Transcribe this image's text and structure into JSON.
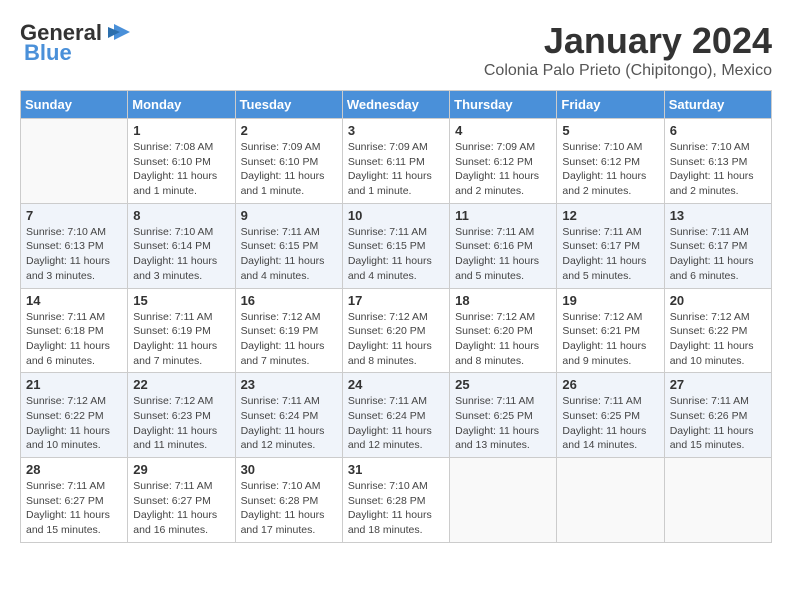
{
  "logo": {
    "general": "General",
    "blue": "Blue"
  },
  "title": {
    "month": "January 2024",
    "location": "Colonia Palo Prieto (Chipitongo), Mexico"
  },
  "headers": [
    "Sunday",
    "Monday",
    "Tuesday",
    "Wednesday",
    "Thursday",
    "Friday",
    "Saturday"
  ],
  "weeks": [
    [
      {
        "day": "",
        "info": ""
      },
      {
        "day": "1",
        "info": "Sunrise: 7:08 AM\nSunset: 6:10 PM\nDaylight: 11 hours\nand 1 minute."
      },
      {
        "day": "2",
        "info": "Sunrise: 7:09 AM\nSunset: 6:10 PM\nDaylight: 11 hours\nand 1 minute."
      },
      {
        "day": "3",
        "info": "Sunrise: 7:09 AM\nSunset: 6:11 PM\nDaylight: 11 hours\nand 1 minute."
      },
      {
        "day": "4",
        "info": "Sunrise: 7:09 AM\nSunset: 6:12 PM\nDaylight: 11 hours\nand 2 minutes."
      },
      {
        "day": "5",
        "info": "Sunrise: 7:10 AM\nSunset: 6:12 PM\nDaylight: 11 hours\nand 2 minutes."
      },
      {
        "day": "6",
        "info": "Sunrise: 7:10 AM\nSunset: 6:13 PM\nDaylight: 11 hours\nand 2 minutes."
      }
    ],
    [
      {
        "day": "7",
        "info": "Sunrise: 7:10 AM\nSunset: 6:13 PM\nDaylight: 11 hours\nand 3 minutes."
      },
      {
        "day": "8",
        "info": "Sunrise: 7:10 AM\nSunset: 6:14 PM\nDaylight: 11 hours\nand 3 minutes."
      },
      {
        "day": "9",
        "info": "Sunrise: 7:11 AM\nSunset: 6:15 PM\nDaylight: 11 hours\nand 4 minutes."
      },
      {
        "day": "10",
        "info": "Sunrise: 7:11 AM\nSunset: 6:15 PM\nDaylight: 11 hours\nand 4 minutes."
      },
      {
        "day": "11",
        "info": "Sunrise: 7:11 AM\nSunset: 6:16 PM\nDaylight: 11 hours\nand 5 minutes."
      },
      {
        "day": "12",
        "info": "Sunrise: 7:11 AM\nSunset: 6:17 PM\nDaylight: 11 hours\nand 5 minutes."
      },
      {
        "day": "13",
        "info": "Sunrise: 7:11 AM\nSunset: 6:17 PM\nDaylight: 11 hours\nand 6 minutes."
      }
    ],
    [
      {
        "day": "14",
        "info": "Sunrise: 7:11 AM\nSunset: 6:18 PM\nDaylight: 11 hours\nand 6 minutes."
      },
      {
        "day": "15",
        "info": "Sunrise: 7:11 AM\nSunset: 6:19 PM\nDaylight: 11 hours\nand 7 minutes."
      },
      {
        "day": "16",
        "info": "Sunrise: 7:12 AM\nSunset: 6:19 PM\nDaylight: 11 hours\nand 7 minutes."
      },
      {
        "day": "17",
        "info": "Sunrise: 7:12 AM\nSunset: 6:20 PM\nDaylight: 11 hours\nand 8 minutes."
      },
      {
        "day": "18",
        "info": "Sunrise: 7:12 AM\nSunset: 6:20 PM\nDaylight: 11 hours\nand 8 minutes."
      },
      {
        "day": "19",
        "info": "Sunrise: 7:12 AM\nSunset: 6:21 PM\nDaylight: 11 hours\nand 9 minutes."
      },
      {
        "day": "20",
        "info": "Sunrise: 7:12 AM\nSunset: 6:22 PM\nDaylight: 11 hours\nand 10 minutes."
      }
    ],
    [
      {
        "day": "21",
        "info": "Sunrise: 7:12 AM\nSunset: 6:22 PM\nDaylight: 11 hours\nand 10 minutes."
      },
      {
        "day": "22",
        "info": "Sunrise: 7:12 AM\nSunset: 6:23 PM\nDaylight: 11 hours\nand 11 minutes."
      },
      {
        "day": "23",
        "info": "Sunrise: 7:11 AM\nSunset: 6:24 PM\nDaylight: 11 hours\nand 12 minutes."
      },
      {
        "day": "24",
        "info": "Sunrise: 7:11 AM\nSunset: 6:24 PM\nDaylight: 11 hours\nand 12 minutes."
      },
      {
        "day": "25",
        "info": "Sunrise: 7:11 AM\nSunset: 6:25 PM\nDaylight: 11 hours\nand 13 minutes."
      },
      {
        "day": "26",
        "info": "Sunrise: 7:11 AM\nSunset: 6:25 PM\nDaylight: 11 hours\nand 14 minutes."
      },
      {
        "day": "27",
        "info": "Sunrise: 7:11 AM\nSunset: 6:26 PM\nDaylight: 11 hours\nand 15 minutes."
      }
    ],
    [
      {
        "day": "28",
        "info": "Sunrise: 7:11 AM\nSunset: 6:27 PM\nDaylight: 11 hours\nand 15 minutes."
      },
      {
        "day": "29",
        "info": "Sunrise: 7:11 AM\nSunset: 6:27 PM\nDaylight: 11 hours\nand 16 minutes."
      },
      {
        "day": "30",
        "info": "Sunrise: 7:10 AM\nSunset: 6:28 PM\nDaylight: 11 hours\nand 17 minutes."
      },
      {
        "day": "31",
        "info": "Sunrise: 7:10 AM\nSunset: 6:28 PM\nDaylight: 11 hours\nand 18 minutes."
      },
      {
        "day": "",
        "info": ""
      },
      {
        "day": "",
        "info": ""
      },
      {
        "day": "",
        "info": ""
      }
    ]
  ]
}
